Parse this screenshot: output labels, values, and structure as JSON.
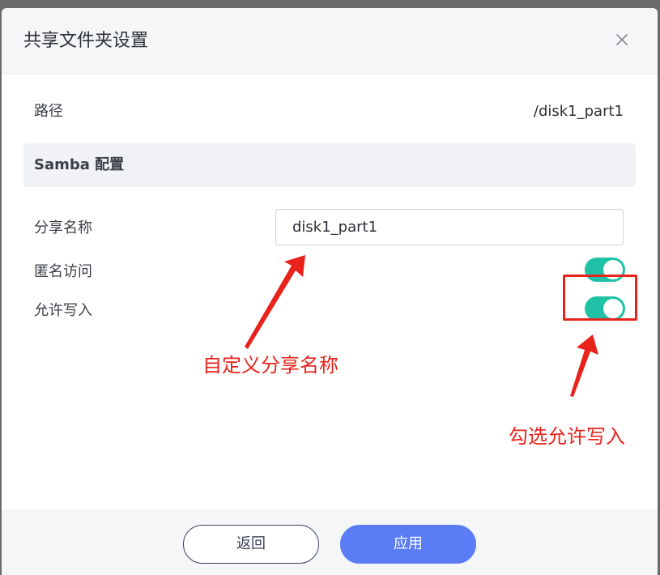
{
  "dialog": {
    "title": "共享文件夹设置",
    "close_icon": "close-icon"
  },
  "path": {
    "label": "路径",
    "value": "/disk1_part1"
  },
  "samba_section": {
    "title": "Samba 配置"
  },
  "share_name": {
    "label": "分享名称",
    "value": "disk1_part1"
  },
  "anonymous_access": {
    "label": "匿名访问",
    "enabled": true
  },
  "allow_write": {
    "label": "允许写入",
    "enabled": true
  },
  "annotations": {
    "share_name_note": "自定义分享名称",
    "allow_write_note": "勾选允许写入"
  },
  "footer": {
    "back_label": "返回",
    "apply_label": "应用"
  },
  "colors": {
    "toggle_on": "#1fc2a7",
    "primary": "#5a7cf5",
    "annotation": "#e8231c"
  }
}
